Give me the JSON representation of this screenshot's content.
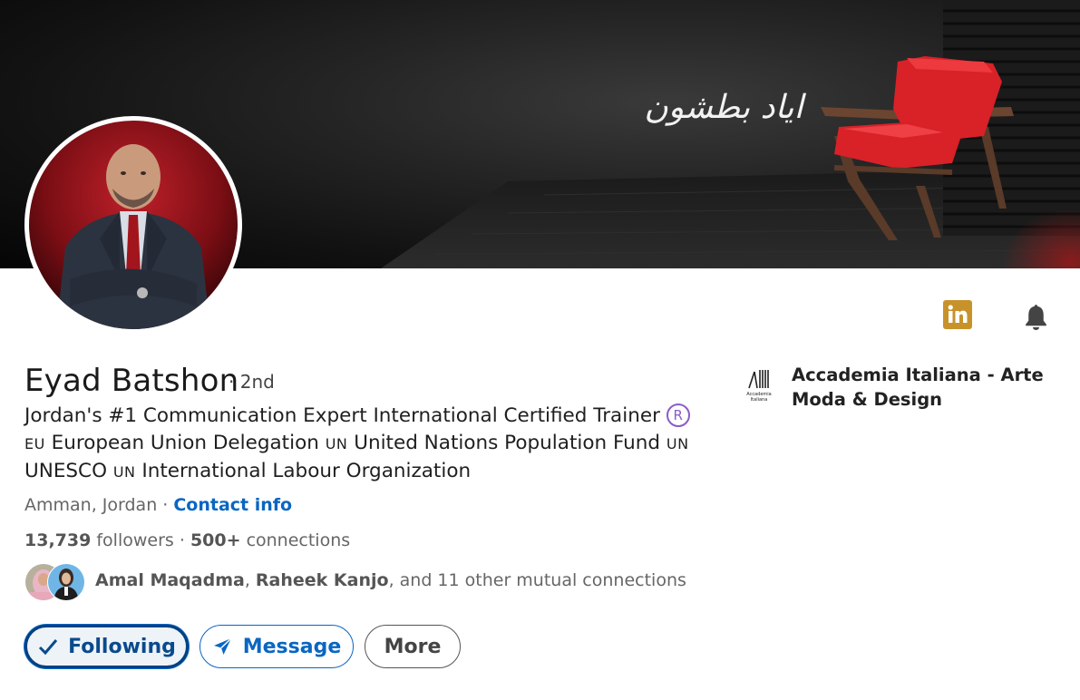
{
  "banner": {
    "signature_text": "اياد بطشون"
  },
  "profile": {
    "name": "Eyad Batshon",
    "degree": "· 2nd",
    "headline_line1": "Jordan's #1 Communication Expert International Certified Trainer",
    "registered_mark": "R",
    "headline_line2_prefix": "EU",
    "headline_line2_a": " European Union Delegation ",
    "headline_line2_un": "UN",
    "headline_line2_b": " United Nations Population Fund ",
    "headline_line2_un2": "UN",
    "headline_line3_a": "UNESCO ",
    "headline_line3_un": "UN",
    "headline_line3_b": " International Labour Organization",
    "location": "Amman, Jordan",
    "location_sep": " · ",
    "contact_info": "Contact info",
    "followers_count": "13,739",
    "followers_label": " followers ",
    "connections_sep": " · ",
    "connections_count": "500+",
    "connections_label": " connections"
  },
  "mutual": {
    "name1": "Amal Maqadma",
    "sep": ", ",
    "name2": "Raheek Kanjo",
    "rest": ", and 11 other mutual connections"
  },
  "actions": {
    "following": "Following",
    "message": "Message",
    "more": "More"
  },
  "company": {
    "name": "Accademia Italiana - Arte Moda & Design",
    "logo_text_1": "Accademia",
    "logo_text_2": "Italiana"
  },
  "icons": {
    "linkedin": "linkedin-icon",
    "bell": "bell-icon",
    "check": "check-icon",
    "send": "send-icon"
  },
  "colors": {
    "linkedin_blue": "#0a66c2",
    "linkedin_icon_gold": "#c8922a",
    "chair_red": "#d92128"
  }
}
